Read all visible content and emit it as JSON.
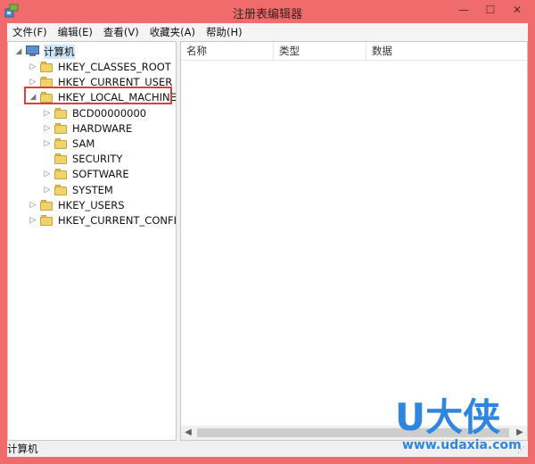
{
  "window": {
    "title": "注册表编辑器"
  },
  "controls": {
    "min": "—",
    "max": "☐",
    "close": "✕"
  },
  "menu": [
    "文件(F)",
    "编辑(E)",
    "查看(V)",
    "收藏夹(A)",
    "帮助(H)"
  ],
  "tree": {
    "root": "计算机",
    "nodes": [
      {
        "label": "HKEY_CLASSES_ROOT",
        "expander": "▷"
      },
      {
        "label": "HKEY_CURRENT_USER",
        "expander": "▷"
      },
      {
        "label": "HKEY_LOCAL_MACHINE",
        "expander": "◢",
        "highlighted": true
      },
      {
        "label": "BCD00000000",
        "expander": "▷"
      },
      {
        "label": "HARDWARE",
        "expander": "▷"
      },
      {
        "label": "SAM",
        "expander": "▷"
      },
      {
        "label": "SECURITY",
        "expander": ""
      },
      {
        "label": "SOFTWARE",
        "expander": "▷"
      },
      {
        "label": "SYSTEM",
        "expander": "▷"
      },
      {
        "label": "HKEY_USERS",
        "expander": "▷"
      },
      {
        "label": "HKEY_CURRENT_CONFIG",
        "expander": "▷"
      }
    ]
  },
  "list": {
    "columns": [
      "名称",
      "类型",
      "数据"
    ]
  },
  "status": {
    "text": "计算机"
  },
  "scroll": {
    "left": "◀",
    "right": "▶"
  },
  "watermark": {
    "big": "U大侠",
    "url": "www.udaxia.com"
  },
  "colors": {
    "frame": "#f06b6b",
    "highlight": "#e23b3b",
    "watermark": "#2e86e0",
    "folder": "#f2d26b"
  }
}
